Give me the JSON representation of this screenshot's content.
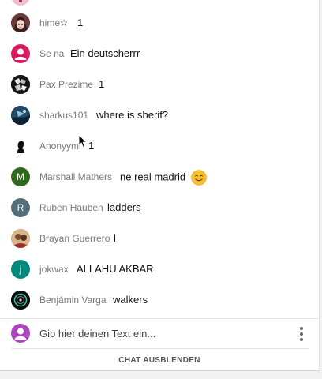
{
  "messages": [
    {
      "author": "hime✫",
      "text": "1"
    },
    {
      "author": "Se na",
      "text": "Ein deutscherrr"
    },
    {
      "author": "Pax Prezime",
      "text": "1"
    },
    {
      "author": "sharkus101",
      "text": "where is sherif?"
    },
    {
      "author": "Anonyymi",
      "text": "1"
    },
    {
      "author": "Marshall Mathers",
      "text": "ne real madrid",
      "emoji": "smiling-face-emoji",
      "avatar_letter": "M"
    },
    {
      "author": "Ruben Hauben",
      "text": "ladders",
      "avatar_letter": "R"
    },
    {
      "author": "Brayan Guerrero",
      "text": "l"
    },
    {
      "author": "jokwax",
      "text": "ALLAHU AKBAR",
      "avatar_letter": "j"
    },
    {
      "author": "Benjámin Varga",
      "text": "walkers"
    }
  ],
  "input": {
    "placeholder": "Gib hier deinen Text ein..."
  },
  "hide_chat_label": "CHAT AUSBLENDEN",
  "colors": {
    "marshall_avatar": "#33691e",
    "ruben_avatar": "#546e7a",
    "jokwax_avatar": "#00897b",
    "sena_avatar": "#d81b60",
    "self_avatar": "#ab47bc"
  },
  "icons": [
    "default-user-icon",
    "more-vert-icon",
    "smiling-face-emoji",
    "mouse-cursor-icon"
  ]
}
